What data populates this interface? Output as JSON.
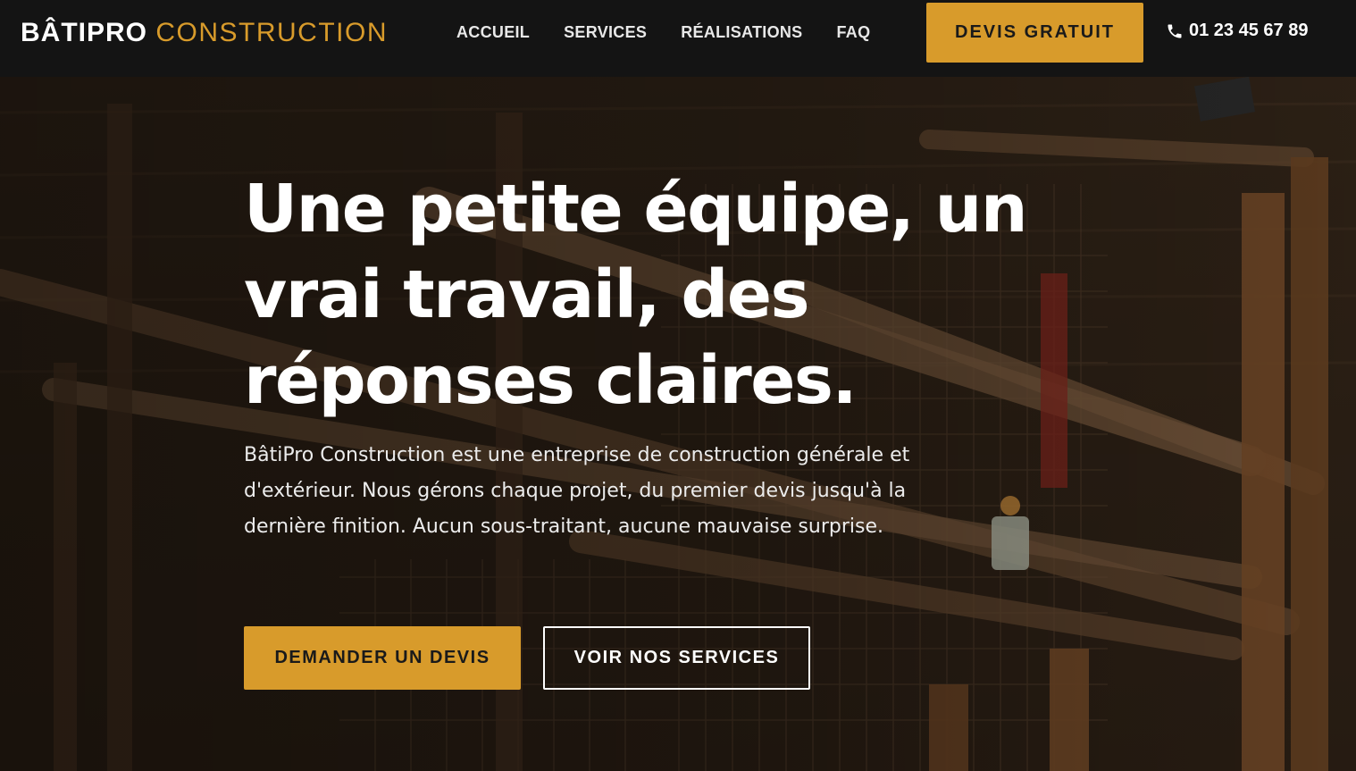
{
  "header": {
    "brand_bold": "BÂTIPRO",
    "brand_light": "CONSTRUCTION",
    "nav": [
      "ACCUEIL",
      "SERVICES",
      "RÉALISATIONS",
      "FAQ"
    ],
    "cta": "DEVIS GRATUIT",
    "phone": "01 23 45 67 89",
    "phone_icon": "phone-icon"
  },
  "hero": {
    "title": "Une petite équipe, un vrai travail, des réponses claires.",
    "text": "BâtiPro Construction est une entreprise de construction générale et d'extérieur. Nous gérons chaque projet, du premier devis jusqu'à la dernière finition. Aucun sous-traitant, aucune mauvaise surprise.",
    "primary_button": "DEMANDER UN DEVIS",
    "secondary_button": "VOIR NOS SERVICES"
  },
  "colors": {
    "accent": "#D89B2B",
    "header_bg": "#141414",
    "text": "#FFFFFF"
  }
}
